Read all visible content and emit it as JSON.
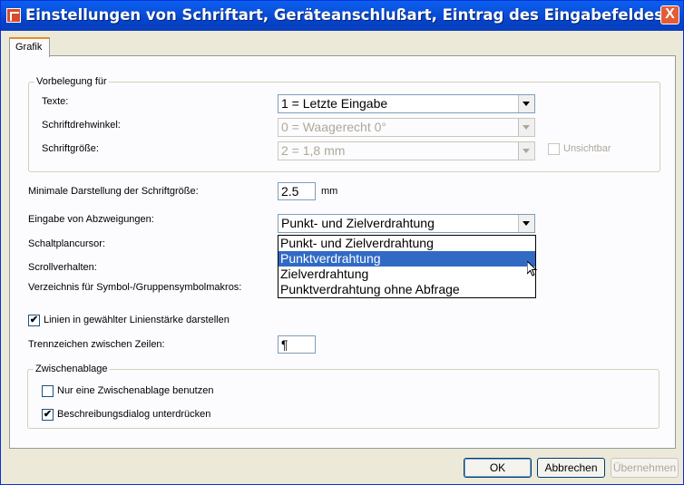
{
  "window": {
    "title": "Einstellungen von Schriftart, Geräteanschlußart, Eintrag des Eingabefeldes",
    "close_label": "X"
  },
  "tabs": [
    {
      "label": "Grafik",
      "active": true
    }
  ],
  "vorbelegung": {
    "group_label": "Vorbelegung für",
    "texte_label": "Texte:",
    "texte_value": "1 = Letzte Eingabe",
    "schriftdrehwinkel_label": "Schriftdrehwinkel:",
    "schriftdrehwinkel_value": "0 = Waagerecht  0°",
    "schriftgroesse_label": "Schriftgröße:",
    "schriftgroesse_value": "2 =  1,8 mm",
    "unsichtbar_label": "Unsichtbar"
  },
  "min_size": {
    "label": "Minimale Darstellung der Schriftgröße:",
    "value": "2.5",
    "unit": "mm"
  },
  "abzweigungen": {
    "label": "Eingabe von Abzweigungen:",
    "value": "Punkt- und Zielverdrahtung",
    "options": [
      "Punkt- und Zielverdrahtung",
      "Punktverdrahtung",
      "Zielverdrahtung",
      "Punktverdrahtung ohne Abfrage"
    ],
    "highlighted_index": 1
  },
  "schaltplancursor_label": "Schaltplancursor:",
  "scrollverhalten_label": "Scrollverhalten:",
  "verzeichnis_label": "Verzeichnis für Symbol-/Gruppensymbolmakros:",
  "linien": {
    "label": "Linien in gewählter Linienstärke darstellen",
    "checked": true,
    "mark": "✔"
  },
  "trennzeichen": {
    "label": "Trennzeichen zwischen Zeilen:",
    "value": "¶"
  },
  "zwischenablage": {
    "group_label": "Zwischenablage",
    "nur_eine_label": "Nur eine Zwischenablage benutzen",
    "beschreibung_label": "Beschreibungsdialog unterdrücken",
    "beschreibung_mark": "✔"
  },
  "buttons": {
    "ok": "OK",
    "abbrechen": "Abbrechen",
    "uebernehmen": "Übernehmen"
  },
  "colors": {
    "titlebar": "#0a5fef",
    "selection": "#316ac5",
    "dialog_bg": "#ece9d8"
  }
}
